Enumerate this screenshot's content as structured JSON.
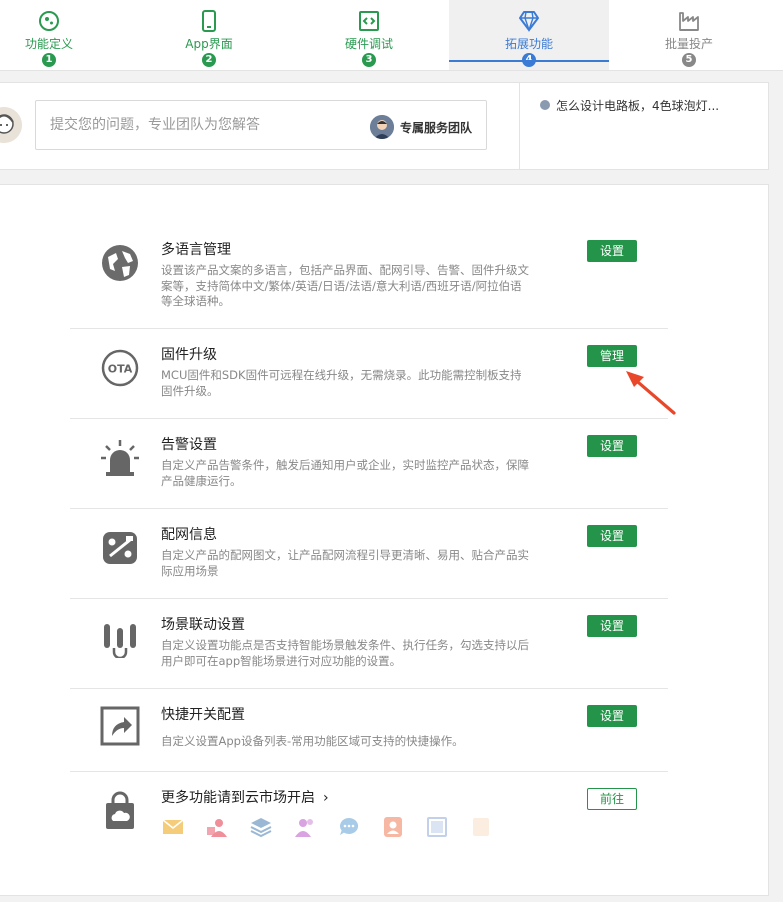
{
  "steps": [
    {
      "label": "功能定义",
      "num": "1",
      "icon": "puzzle-icon",
      "state": "done"
    },
    {
      "label": "App界面",
      "num": "2",
      "icon": "phone-icon",
      "state": "done"
    },
    {
      "label": "硬件调试",
      "num": "3",
      "icon": "chip-debug-icon",
      "state": "done"
    },
    {
      "label": "拓展功能",
      "num": "4",
      "icon": "diamond-icon",
      "state": "active"
    },
    {
      "label": "批量投产",
      "num": "5",
      "icon": "factory-icon",
      "state": "todo"
    }
  ],
  "help": {
    "placeholder": "提交您的问题，专业团队为您解答",
    "team_label": "专属服务团队",
    "faq_text": "怎么设计电路板，4色球泡灯..."
  },
  "features": [
    {
      "title": "多语言管理",
      "desc": "设置该产品文案的多语言，包括产品界面、配网引导、告警、固件升级文案等，支持简体中文/繁体/英语/日语/法语/意大利语/西班牙语/阿拉伯语等全球语种。",
      "button": "设置",
      "icon": "globe-icon"
    },
    {
      "title": "固件升级",
      "desc": "MCU固件和SDK固件可远程在线升级，无需烧录。此功能需控制板支持固件升级。",
      "button": "管理",
      "icon": "ota-icon"
    },
    {
      "title": "告警设置",
      "desc": "自定义产品告警条件，触发后通知用户或企业，实时监控产品状态，保障产品健康运行。",
      "button": "设置",
      "icon": "alarm-light-icon"
    },
    {
      "title": "配网信息",
      "desc": "自定义产品的配网图文，让产品配网流程引导更清晰、易用、贴合产品实际应用场景",
      "button": "设置",
      "icon": "network-config-icon"
    },
    {
      "title": "场景联动设置",
      "desc": "自定义设置功能点是否支持智能场景触发条件、执行任务，勾选支持以后用户即可在app智能场景进行对应功能的设置。",
      "button": "设置",
      "icon": "scene-link-icon"
    },
    {
      "title": "快捷开关配置",
      "desc": "自定义设置App设备列表-常用功能区域可支持的快捷操作。",
      "button": "设置",
      "icon": "shortcut-icon"
    }
  ],
  "more": {
    "title": "更多功能请到云市场开启",
    "chevron": "›",
    "button": "前往",
    "icon": "bag-cloud-icon"
  },
  "colors": {
    "green": "#24944a",
    "blue": "#3a7bd5",
    "arrow": "#e8472a"
  }
}
